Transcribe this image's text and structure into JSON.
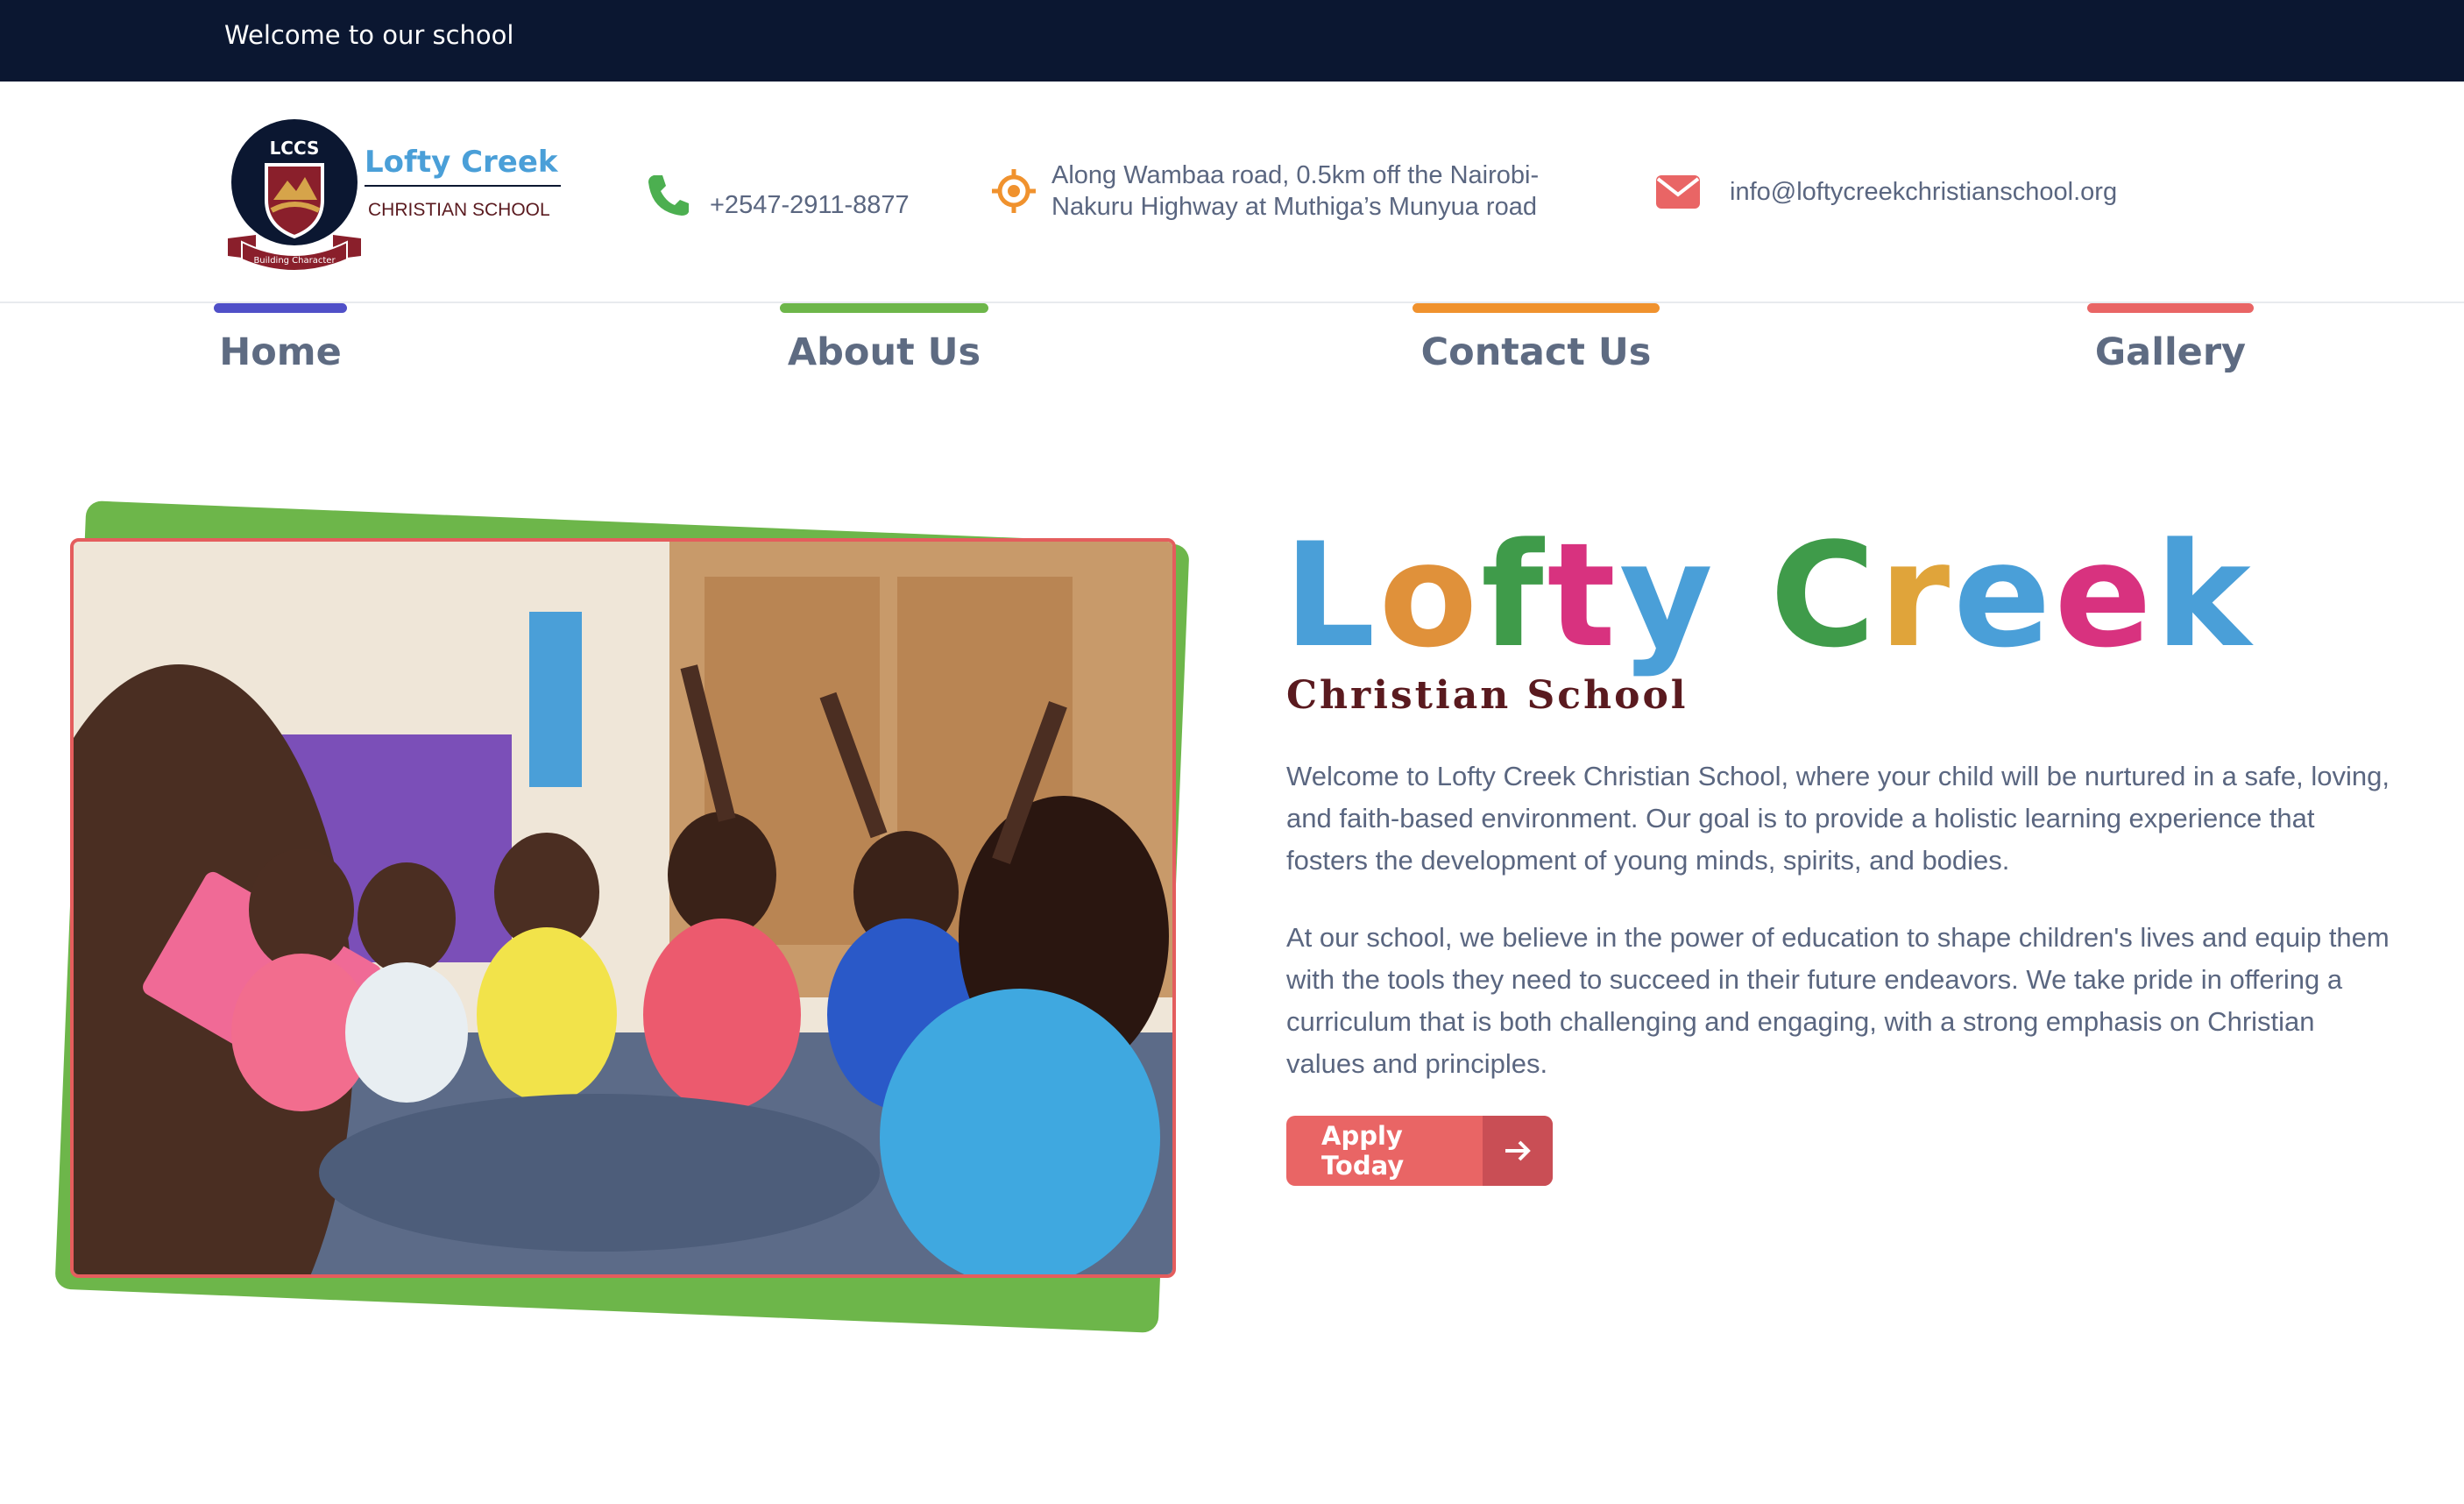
{
  "topbar": {
    "welcome": "Welcome to our school"
  },
  "logo": {
    "initials": "LCCS",
    "name": "Lofty Creek",
    "subname": "CHRISTIAN SCHOOL",
    "motto": "Building Character"
  },
  "contact": {
    "phone": "+2547-2911-8877",
    "address_line1": "Along Wambaa road, 0.5km off the Nairobi-",
    "address_line2": "Nakuru Highway at Muthiga’s Munyua road",
    "email": "info@loftycreekchristianschool.org"
  },
  "nav": [
    {
      "label": "Home",
      "color": "#5050c8"
    },
    {
      "label": "About Us",
      "color": "#6db64a"
    },
    {
      "label": "Contact Us",
      "color": "#f0922e"
    },
    {
      "label": "Gallery",
      "color": "#e96565"
    }
  ],
  "hero": {
    "title_letters": [
      {
        "ch": "L",
        "color": "#4a9fd8"
      },
      {
        "ch": "o",
        "color": "#e0913a"
      },
      {
        "ch": "f",
        "color": "#3f9b4a"
      },
      {
        "ch": "t",
        "color": "#d8327f"
      },
      {
        "ch": "y",
        "color": "#4a9fd8"
      },
      {
        "ch": " ",
        "color": "#ffffff"
      },
      {
        "ch": "C",
        "color": "#3f9b4a"
      },
      {
        "ch": "r",
        "color": "#e0a43a"
      },
      {
        "ch": "e",
        "color": "#4a9fd8"
      },
      {
        "ch": "e",
        "color": "#d8327f"
      },
      {
        "ch": "k",
        "color": "#4a9fd8"
      }
    ],
    "subtitle": "Christian School",
    "paragraph1": "Welcome to Lofty Creek Christian School, where your child will be nurtured in a safe, loving, and faith-based environment. Our goal is to provide a holistic learning experience that fosters the development of young minds, spirits, and bodies.",
    "paragraph2": "At our school, we believe in the power of education to shape children's lives and equip them with the tools they need to succeed in their future endeavors. We take pride in offering a curriculum that is both challenging and engaging, with a strong emphasis on Christian values and principles.",
    "cta_label": "Apply Today"
  },
  "icons": {
    "phone": "phone-icon",
    "location": "location-icon",
    "email": "envelope-icon",
    "cta": "arrow-right-icon"
  }
}
